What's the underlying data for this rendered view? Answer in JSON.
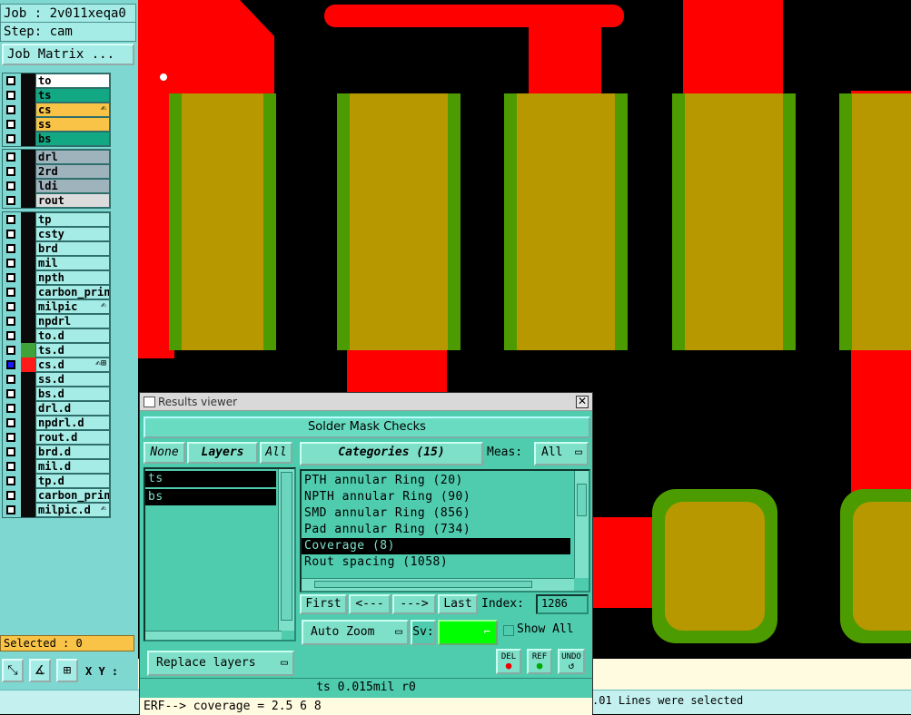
{
  "job": {
    "label": "Job : 2v011xeqa0",
    "step": "Step: cam",
    "matrix_button": "Job Matrix ..."
  },
  "layer_groups": [
    [
      {
        "name": "to",
        "color": "#ffffff",
        "mark": ""
      },
      {
        "name": "ts",
        "color": "#13a884",
        "mark": ""
      },
      {
        "name": "cs",
        "color": "#f8c347",
        "mark": "✍"
      },
      {
        "name": "ss",
        "color": "#f8c347",
        "mark": ""
      },
      {
        "name": "bs",
        "color": "#13a884",
        "mark": ""
      }
    ],
    [
      {
        "name": "drl",
        "color": "#9fb3bd",
        "mark": ""
      },
      {
        "name": "2rd",
        "color": "#9fb3bd",
        "mark": ""
      },
      {
        "name": "ldi",
        "color": "#9fb3bd",
        "mark": ""
      },
      {
        "name": "rout",
        "color": "#dcdcdc",
        "mark": ""
      }
    ],
    [
      {
        "name": "tp",
        "color": "#a6ece6",
        "mark": ""
      },
      {
        "name": "csty",
        "color": "#a6ece6",
        "mark": ""
      },
      {
        "name": "brd",
        "color": "#a6ece6",
        "mark": ""
      },
      {
        "name": "mil",
        "color": "#a6ece6",
        "mark": ""
      },
      {
        "name": "npth",
        "color": "#a6ece6",
        "mark": ""
      },
      {
        "name": "carbon_print",
        "color": "#a6ece6",
        "mark": ""
      },
      {
        "name": "milpic",
        "color": "#a6ece6",
        "mark": "✍"
      },
      {
        "name": "npdrl",
        "color": "#a6ece6",
        "mark": ""
      },
      {
        "name": "to.d",
        "color": "#a6ece6",
        "mark": ""
      },
      {
        "name": "ts.d",
        "color": "#a6ece6",
        "mark": "",
        "swatch": "#3fa33a"
      },
      {
        "name": "cs.d",
        "color": "#a6ece6",
        "mark": "✍⊞",
        "swatch": "#ff1a1a",
        "active": true
      },
      {
        "name": "ss.d",
        "color": "#a6ece6",
        "mark": ""
      },
      {
        "name": "bs.d",
        "color": "#a6ece6",
        "mark": ""
      },
      {
        "name": "drl.d",
        "color": "#a6ece6",
        "mark": ""
      },
      {
        "name": "npdrl.d",
        "color": "#a6ece6",
        "mark": ""
      },
      {
        "name": "rout.d",
        "color": "#a6ece6",
        "mark": ""
      },
      {
        "name": "brd.d",
        "color": "#a6ece6",
        "mark": ""
      },
      {
        "name": "mil.d",
        "color": "#a6ece6",
        "mark": ""
      },
      {
        "name": "tp.d",
        "color": "#a6ece6",
        "mark": ""
      },
      {
        "name": "carbon_print",
        "color": "#a6ece6",
        "mark": ""
      },
      {
        "name": "milpic.d",
        "color": "#a6ece6",
        "mark": "✍"
      }
    ]
  ],
  "selected": "Selected : 0",
  "xy_label": "X Y :",
  "results_viewer": {
    "window_title": "Results viewer",
    "header": "Solder Mask Checks",
    "none_btn": "None",
    "layers_btn": "Layers",
    "all_btn": "All",
    "layers": [
      "ts",
      "bs"
    ],
    "categories_btn": "Categories (15)",
    "meas_label": "Meas:",
    "meas_value": "All",
    "categories": [
      {
        "text": "PTH annular Ring (20)",
        "selected": false
      },
      {
        "text": "NPTH annular Ring (90)",
        "selected": false
      },
      {
        "text": "SMD annular Ring (856)",
        "selected": false
      },
      {
        "text": "Pad annular Ring (734)",
        "selected": false
      },
      {
        "text": "Coverage (8)",
        "selected": true
      },
      {
        "text": "Rout spacing (1058)",
        "selected": false
      }
    ],
    "first_btn": "First",
    "prev_btn": "<---",
    "next_btn": "--->",
    "last_btn": "Last",
    "index_label": "Index:",
    "index_value": "1286",
    "autozoom": "Auto Zoom",
    "sv_label": "Sv:",
    "show_all": "Show All",
    "replace_layers": "Replace layers",
    "del": "DEL",
    "ref": "REF",
    "undo": "UNDO",
    "status": "ts 0.015mil  r0",
    "erf": "ERF--> coverage = 2.5 6 8"
  },
  "bottom_message": ".01 Lines were selected",
  "colors": {
    "copper": "#ff0000",
    "mask": "#4c9b00",
    "overlap": "#b89800"
  }
}
